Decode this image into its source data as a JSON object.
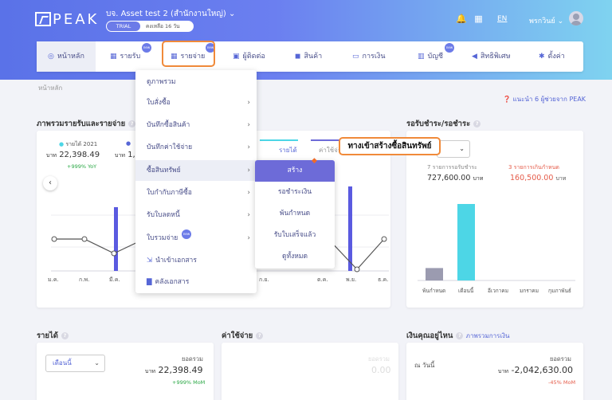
{
  "header": {
    "logo_text": "PEAK",
    "company": "บจ. Asset test 2 (สำนักงานใหญ่)",
    "trial_label": "TRIAL",
    "remaining": "คงเหลือ 16 วัน",
    "language": "EN",
    "user_name": "พรกวินย์"
  },
  "nav": {
    "home": "หน้าหลัก",
    "income": "รายรับ",
    "expense": "รายจ่าย",
    "contacts": "ผู้ติดต่อ",
    "products": "สินค้า",
    "finance": "การเงิน",
    "accounts": "บัญชี",
    "privileges": "สิทธิพิเศษ",
    "settings": "ตั้งค่า",
    "badge": "new"
  },
  "breadcrumb": "หน้าหลัก",
  "helper_link": "แนะนำ 6 ผู้ช่วยจาก PEAK",
  "dropdown": {
    "items": [
      {
        "label": "ดูภาพรวม",
        "arrow": ""
      },
      {
        "label": "ใบสั่งซื้อ",
        "arrow": "›"
      },
      {
        "label": "บันทึกซื้อสินค้า",
        "arrow": "›"
      },
      {
        "label": "บันทึกค่าใช้จ่าย",
        "arrow": "›"
      },
      {
        "label": "ซื้อสินทรัพย์",
        "arrow": "›"
      },
      {
        "label": "ใบกำกับภาษีซื้อ",
        "arrow": "›"
      },
      {
        "label": "รับใบลดหนี้",
        "arrow": "›"
      },
      {
        "label": "ใบรวมจ่าย",
        "arrow": "›"
      },
      {
        "label": "นำเข้าเอกสาร",
        "arrow": ""
      },
      {
        "label": "คลังเอกสาร",
        "arrow": ""
      }
    ]
  },
  "submenu": {
    "items": [
      "สร้าง",
      "รอชำระเงิน",
      "พ้นกำหนด",
      "รับใบเสร็จแล้ว",
      "ดูทั้งหมด"
    ]
  },
  "callout": "ทางเข้าสร้างซื้อสินทรัพย์",
  "overview": {
    "title": "ภาพรวมรายรับและรายจ่าย",
    "legend_income": "รายได้ 2021",
    "currency": "บาท",
    "income_value": "22,398.49",
    "expense_partial": "1,49",
    "yoy": "+999% YoY",
    "tab_income": "รายได้",
    "tab_expense": "ค่าใช้จ่าย",
    "months": [
      "ม.ค.",
      "ก.พ.",
      "มี.ค.",
      "ก.ย.",
      "ต.ค.",
      "พ.ย.",
      "ธ.ค."
    ]
  },
  "receivables": {
    "title": "รอรับชำระ/รอชำระ",
    "pending_label": "7 รายการรอรับชำระ",
    "pending_value": "727,600.00",
    "overdue_label": "3 รายการเกินกำหนด",
    "overdue_value": "160,500.00",
    "currency": "บาท",
    "categories": [
      "พ้นกำหนด",
      "เดือนนี้",
      "อีเวกาคม",
      "มกราคม",
      "กุมภาพันธ์"
    ],
    "bar_color_overdue": "#9b9bb0",
    "bar_color_current": "#4dd6e6"
  },
  "income_card": {
    "title": "รายได้",
    "select": "เดือนนี้",
    "total_label": "ยอดรวม",
    "currency": "บาท",
    "value": "22,398.49",
    "mom": "+999% MoM"
  },
  "expense_card": {
    "title": "ค่าใช้จ่าย",
    "total_label": "ยอดรวม",
    "value": "0.00"
  },
  "cash_card": {
    "title": "เงินคุณอยู่ไหน",
    "link": "ภาพรวมการเงิน",
    "date_label": "ณ วันนี้",
    "total_label": "ยอดรวม",
    "currency": "บาท",
    "value": "-2,042,630.00",
    "mom": "-45% MoM"
  },
  "chart_data": [
    {
      "type": "bar",
      "categories": [
        "พ้นกำหนด",
        "เดือนนี้",
        "อีเวกาคม",
        "มกราคม",
        "กุมภาพันธ์"
      ],
      "values": [
        65000,
        400000,
        0,
        0,
        0
      ],
      "title": "รอรับชำระ/รอชำระ"
    }
  ]
}
